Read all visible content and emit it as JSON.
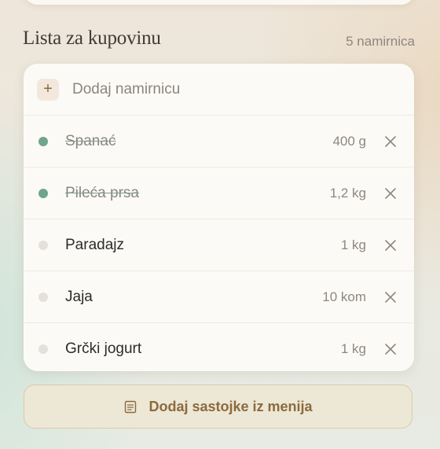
{
  "header": {
    "title": "Lista za kupovinu",
    "count": "5 namirnica"
  },
  "add_field": {
    "icon": "plus-icon",
    "icon_glyph": "+",
    "placeholder": "Dodaj namirnicu",
    "value": ""
  },
  "items": [
    {
      "name": "Spanać",
      "quantity": "400 g",
      "checked": true
    },
    {
      "name": "Pileća prsa",
      "quantity": "1,2 kg",
      "checked": true
    },
    {
      "name": "Paradajz",
      "quantity": "1 kg",
      "checked": false
    },
    {
      "name": "Jaja",
      "quantity": "10 kom",
      "checked": false
    },
    {
      "name": "Grčki jogurt",
      "quantity": "1 kg",
      "checked": false
    }
  ],
  "remove_icon": "close-icon",
  "menu_button": {
    "icon": "document-icon",
    "label": "Dodaj sastojke iz menija"
  },
  "colors": {
    "accent": "#8b6a3d",
    "checked_dot": "#6fa58a",
    "unchecked_dot": "#e4e0db"
  }
}
